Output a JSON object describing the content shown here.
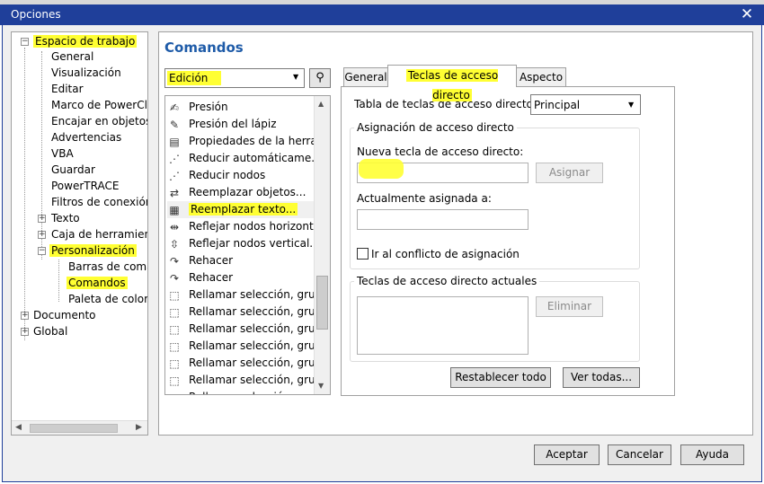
{
  "window": {
    "title": "Opciones",
    "close_symbol": "✕"
  },
  "tree": {
    "root": "Espacio de trabajo",
    "items": [
      "General",
      "Visualización",
      "Editar",
      "Marco de PowerClip",
      "Encajar en objetos",
      "Advertencias",
      "VBA",
      "Guardar",
      "PowerTRACE",
      "Filtros de conexión",
      "Texto",
      "Caja de herramientas",
      "Personalización"
    ],
    "sub_items": [
      "Barras de comandos",
      "Comandos",
      "Paleta de colores"
    ],
    "others": [
      "Documento",
      "Global"
    ],
    "selected": "Comandos"
  },
  "page": {
    "heading": "Comandos"
  },
  "category": {
    "selected": "Edición",
    "arrow": "▼"
  },
  "commands": [
    {
      "label": "Presión",
      "icon": "pen-pressure-icon",
      "glyph": "✍"
    },
    {
      "label": "Presión del lápiz",
      "icon": "pencil-icon",
      "glyph": "✎"
    },
    {
      "label": "Propiedades de la herra...",
      "icon": "tool-properties-icon",
      "glyph": "▤"
    },
    {
      "label": "Reducir automáticame...",
      "icon": "nodes-icon",
      "glyph": "⋰"
    },
    {
      "label": "Reducir nodos",
      "icon": "nodes-icon",
      "glyph": "⋰"
    },
    {
      "label": "Reemplazar objetos...",
      "icon": "replace-objects-icon",
      "glyph": "⇄"
    },
    {
      "label": "Reemplazar texto...",
      "icon": "replace-text-icon",
      "glyph": "▦"
    },
    {
      "label": "Reflejar nodos horizont...",
      "icon": "mirror-horizontal-icon",
      "glyph": "⇹"
    },
    {
      "label": "Reflejar nodos vertical...",
      "icon": "mirror-vertical-icon",
      "glyph": "⇳"
    },
    {
      "label": "Rehacer",
      "icon": "redo-icon",
      "glyph": "↷"
    },
    {
      "label": "Rehacer",
      "icon": "redo-icon",
      "glyph": "↷"
    },
    {
      "label": "Rellamar selección, gru...",
      "icon": "recall-selection-icon",
      "glyph": "⬚"
    },
    {
      "label": "Rellamar selección, gru...",
      "icon": "recall-selection-icon",
      "glyph": "⬚"
    },
    {
      "label": "Rellamar selección, gru...",
      "icon": "recall-selection-icon",
      "glyph": "⬚"
    },
    {
      "label": "Rellamar selección, gru...",
      "icon": "recall-selection-icon",
      "glyph": "⬚"
    },
    {
      "label": "Rellamar selección, gru...",
      "icon": "recall-selection-icon",
      "glyph": "⬚"
    },
    {
      "label": "Rellamar selección, gru...",
      "icon": "recall-selection-icon",
      "glyph": "⬚"
    },
    {
      "label": "Rellamar selección",
      "icon": "recall-selection-icon",
      "glyph": "⬚"
    }
  ],
  "tabs": [
    "General",
    "Teclas de acceso directo",
    "Aspecto"
  ],
  "shortcuts": {
    "table_label": "Tabla de teclas de acceso directo:",
    "table_value": "Principal",
    "assign_group": "Asignación de acceso directo",
    "new_key_label": "Nueva tecla de acceso directo:",
    "new_key_value": "",
    "assign_button": "Asignar",
    "current_label": "Actualmente asignada a:",
    "current_value": "",
    "conflict_label": "Ir al conflicto de asignación",
    "current_group": "Teclas de acceso directo actuales",
    "delete_button": "Eliminar",
    "reset_button": "Restablecer todo",
    "view_all_button": "Ver todas..."
  },
  "footer": {
    "accept": "Aceptar",
    "cancel": "Cancelar",
    "help": "Ayuda"
  },
  "colors": {
    "title_bar": "#1f3f9a",
    "heading": "#1e5ba8",
    "highlight": "#ffff33"
  }
}
